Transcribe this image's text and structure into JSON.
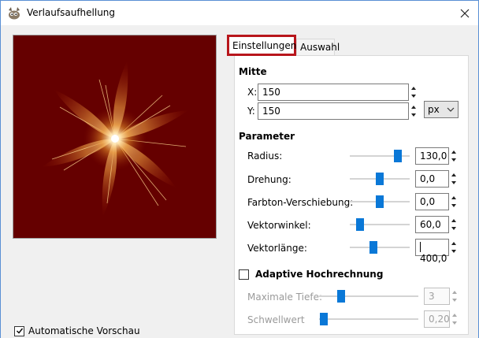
{
  "window": {
    "title": "Verlaufsaufhellung"
  },
  "tabs": [
    {
      "label": "Einstellungen",
      "active": true
    },
    {
      "label": "Auswahl",
      "active": false
    }
  ],
  "mitte": {
    "title": "Mitte",
    "x": {
      "label": "X:",
      "value": "150"
    },
    "y": {
      "label": "Y:",
      "value": "150"
    },
    "unit": "px"
  },
  "parameter": {
    "title": "Parameter",
    "radius": {
      "label": "Radius:",
      "value": "130,0",
      "level": 0.8
    },
    "drehung": {
      "label": "Drehung:",
      "value": "0,0",
      "level": 0.5
    },
    "farbton": {
      "label": "Farbton-Verschiebung:",
      "value": "0,0",
      "level": 0.5
    },
    "vwinkel": {
      "label": "Vektorwinkel:",
      "value": "60,0",
      "level": 0.17
    },
    "vlaenge": {
      "label": "Vektorlänge:",
      "value": "400,0",
      "level": 0.4
    }
  },
  "adaptive": {
    "label": "Adaptive Hochrechnung",
    "checked": false,
    "max_tiefe": {
      "label": "Maximale Tiefe:",
      "value": "3",
      "level": 0.22
    },
    "schwellwert": {
      "label": "Schwellwert",
      "value": "0,20",
      "level": 0.05
    }
  },
  "preview": {
    "label": "Automatische Vorschau",
    "checked": true
  },
  "colors": {
    "accent": "#0a78d7",
    "highlight": "#b8161c",
    "preview_bg": "#650000"
  }
}
